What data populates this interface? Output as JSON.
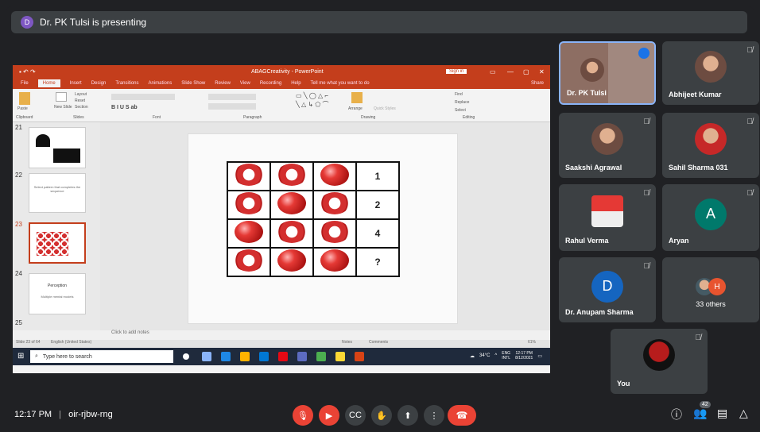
{
  "banner": {
    "initial": "D",
    "text": "Dr. PK Tulsi is presenting"
  },
  "powerpoint": {
    "doc_title": "ABAGCreativity - PowerPoint",
    "sign_in": "Sign in",
    "menu": [
      "File",
      "Home",
      "Insert",
      "Design",
      "Transitions",
      "Animations",
      "Slide Show",
      "Review",
      "View",
      "Recording",
      "Help",
      "Tell me what you want to do"
    ],
    "share": "Share",
    "ribbon_groups": [
      "Clipboard",
      "Slides",
      "Font",
      "Paragraph",
      "Drawing",
      "Editing"
    ],
    "ribbon_labels": {
      "paste": "Paste",
      "new_slide": "New Slide",
      "layout": "Layout",
      "reset": "Reset",
      "section": "Section",
      "arrange": "Arrange",
      "quick_styles": "Quick Styles",
      "find": "Find",
      "replace": "Replace",
      "select": "Select"
    },
    "thumb_numbers": [
      "21",
      "22",
      "23",
      "24",
      "25"
    ],
    "thumb22_text": "Select pattern that completes the sequence",
    "thumb24_title": "Perception",
    "thumb24_text": "Multiple mental models",
    "slide_grid_numbers": [
      "1",
      "2",
      "4",
      "?"
    ],
    "notes_placeholder": "Click to add notes",
    "status_text": "Slide 23 of 64",
    "status_lang": "English (United States)",
    "status_notes": "Notes",
    "status_comments": "Comments",
    "status_zoom": "61%"
  },
  "taskbar": {
    "search_placeholder": "Type here to search",
    "temperature": "34°C",
    "lang": "ENG",
    "lang2": "INTL",
    "time": "12:17 PM",
    "date": "8/12/2021"
  },
  "participants": [
    {
      "name": "Dr. PK Tulsi"
    },
    {
      "name": "Abhijeet Kumar"
    },
    {
      "name": "Saakshi Agrawal"
    },
    {
      "name": "Sahil Sharma 031"
    },
    {
      "name": "Rahul Verma"
    },
    {
      "name": "Aryan",
      "initial": "A"
    },
    {
      "name": "Dr. Anupam Sharma",
      "initial": "D"
    },
    {
      "name": "33 others",
      "initial": "H"
    },
    {
      "name": "You"
    }
  ],
  "meeting": {
    "time": "12:17 PM",
    "code": "oir-rjbw-rng",
    "participant_count": "42"
  },
  "colors": {
    "accent": "#c43e1c",
    "red": "#ea4335",
    "tile": "#3c4043",
    "bg": "#202124"
  }
}
